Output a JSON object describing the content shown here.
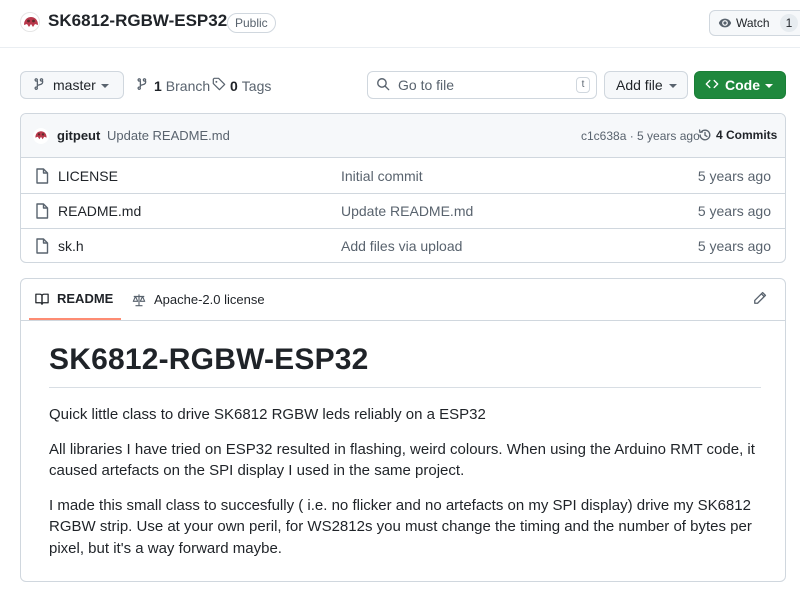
{
  "header": {
    "repo_name": "SK6812-RGBW-ESP32",
    "visibility": "Public",
    "watch_label": "Watch",
    "watch_count": "1"
  },
  "toolbar": {
    "branch": "master",
    "branch_count": "1",
    "branch_label": "Branch",
    "tag_count": "0",
    "tag_label": "Tags",
    "search_placeholder": "Go to file",
    "search_shortcut": "t",
    "add_file_label": "Add file",
    "code_label": "Code"
  },
  "latest_commit": {
    "author": "gitpeut",
    "message": "Update README.md",
    "meta": "c1c638a · 5 years ago",
    "commits_label": "4 Commits"
  },
  "files": [
    {
      "name": "LICENSE",
      "commit": "Initial commit",
      "date": "5 years ago",
      "icon": "file-icon"
    },
    {
      "name": "README.md",
      "commit": "Update README.md",
      "date": "5 years ago",
      "icon": "file-icon"
    },
    {
      "name": "sk.h",
      "commit": "Add files via upload",
      "date": "5 years ago",
      "icon": "file-icon"
    }
  ],
  "readme": {
    "tabs": [
      {
        "label": "README",
        "icon": "book-icon",
        "active": true
      },
      {
        "label": "Apache-2.0 license",
        "icon": "scale-icon",
        "active": false
      }
    ],
    "title": "SK6812-RGBW-ESP32",
    "paragraphs": [
      "Quick little class to drive SK6812 RGBW leds reliably on a ESP32",
      "All libraries I have tried on ESP32 resulted in flashing, weird colours. When using the Arduino RMT code, it caused artefacts on the SPI display I used in the same project.",
      "I made this small class to succesfully ( i.e. no flicker and no artefacts on my SPI display) drive my SK6812 RGBW strip. Use at your own peril, for WS2812s you must change the timing and the number of bytes per pixel, but it's a way forward maybe."
    ]
  },
  "colors": {
    "accent_green": "#1f883d",
    "tab_underline": "#fd8c73",
    "border": "#d0d7de",
    "muted_text": "#59636e"
  }
}
